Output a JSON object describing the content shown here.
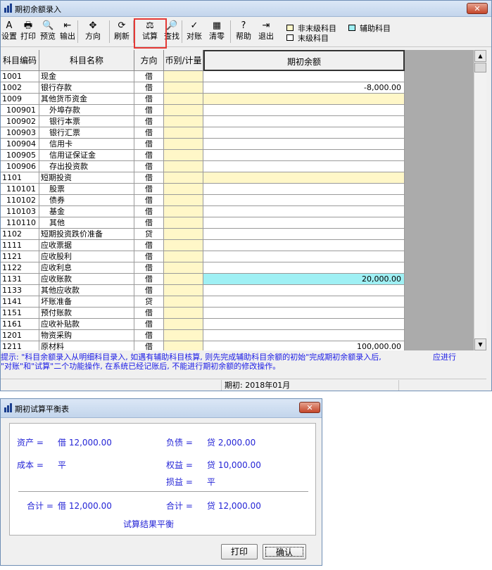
{
  "window1": {
    "title": "期初余额录入",
    "close_label": "✕",
    "toolbar": [
      {
        "label": "设置",
        "icon": "A"
      },
      {
        "label": "打印",
        "icon": "🖶"
      },
      {
        "label": "预览",
        "icon": "🔍"
      },
      {
        "label": "输出",
        "icon": "⇤"
      },
      {
        "label": "方向",
        "icon": "✥"
      },
      {
        "label": "刷新",
        "icon": "⟳"
      },
      {
        "label": "试算",
        "icon": "⚖"
      },
      {
        "label": "查找",
        "icon": "🔎"
      },
      {
        "label": "对账",
        "icon": "✓"
      },
      {
        "label": "清零",
        "icon": "▦"
      },
      {
        "label": "帮助",
        "icon": "?"
      },
      {
        "label": "退出",
        "icon": "⇥"
      }
    ],
    "legend": {
      "non_leaf": "非末级科目",
      "aux": "辅助科目",
      "leaf": "末级科目"
    },
    "legend_colors": {
      "non_leaf": "#fff7c8",
      "aux": "#9ff0f4",
      "leaf": "#ffffff"
    },
    "columns": {
      "code": "科目编码",
      "name": "科目名称",
      "dir": "方向",
      "cur": "币别/计量",
      "amount": "期初余额"
    },
    "rows": [
      {
        "code": "1001",
        "name": "现金",
        "dir": "借",
        "amount": "",
        "type": "leaf"
      },
      {
        "code": "1002",
        "name": "银行存款",
        "dir": "借",
        "amount": "-8,000.00",
        "type": "leaf"
      },
      {
        "code": "1009",
        "name": "其他货币资金",
        "dir": "借",
        "amount": "",
        "type": "parent"
      },
      {
        "code": "100901",
        "name": "外埠存款",
        "dir": "借",
        "amount": "",
        "type": "leaf"
      },
      {
        "code": "100902",
        "name": "银行本票",
        "dir": "借",
        "amount": "",
        "type": "leaf"
      },
      {
        "code": "100903",
        "name": "银行汇票",
        "dir": "借",
        "amount": "",
        "type": "leaf"
      },
      {
        "code": "100904",
        "name": "信用卡",
        "dir": "借",
        "amount": "",
        "type": "leaf"
      },
      {
        "code": "100905",
        "name": "信用证保证金",
        "dir": "借",
        "amount": "",
        "type": "leaf"
      },
      {
        "code": "100906",
        "name": "存出投资款",
        "dir": "借",
        "amount": "",
        "type": "leaf"
      },
      {
        "code": "1101",
        "name": "短期投资",
        "dir": "借",
        "amount": "",
        "type": "parent"
      },
      {
        "code": "110101",
        "name": "股票",
        "dir": "借",
        "amount": "",
        "type": "leaf"
      },
      {
        "code": "110102",
        "name": "债券",
        "dir": "借",
        "amount": "",
        "type": "leaf"
      },
      {
        "code": "110103",
        "name": "基金",
        "dir": "借",
        "amount": "",
        "type": "leaf"
      },
      {
        "code": "110110",
        "name": "其他",
        "dir": "借",
        "amount": "",
        "type": "leaf"
      },
      {
        "code": "1102",
        "name": "短期投资跌价准备",
        "dir": "贷",
        "amount": "",
        "type": "leaf"
      },
      {
        "code": "1111",
        "name": "应收票据",
        "dir": "借",
        "amount": "",
        "type": "leaf"
      },
      {
        "code": "1121",
        "name": "应收股利",
        "dir": "借",
        "amount": "",
        "type": "leaf"
      },
      {
        "code": "1122",
        "name": "应收利息",
        "dir": "借",
        "amount": "",
        "type": "leaf"
      },
      {
        "code": "1131",
        "name": "应收账款",
        "dir": "借",
        "amount": "20,000.00",
        "type": "aux"
      },
      {
        "code": "1133",
        "name": "其他应收款",
        "dir": "借",
        "amount": "",
        "type": "leaf"
      },
      {
        "code": "1141",
        "name": "坏账准备",
        "dir": "贷",
        "amount": "",
        "type": "leaf"
      },
      {
        "code": "1151",
        "name": "预付账款",
        "dir": "借",
        "amount": "",
        "type": "leaf"
      },
      {
        "code": "1161",
        "name": "应收补贴款",
        "dir": "借",
        "amount": "",
        "type": "leaf"
      },
      {
        "code": "1201",
        "name": "物资采购",
        "dir": "借",
        "amount": "",
        "type": "leaf"
      },
      {
        "code": "1211",
        "name": "原材料",
        "dir": "借",
        "amount": "100,000.00",
        "type": "leaf"
      }
    ],
    "tip_line1": "提示: \"科目余额录入从明细科目录入, 如遇有辅助科目核算, 则先完成辅助科目余额的初始\"完成期初余额录入后,",
    "tip_line1_right": "应进行",
    "tip_line2": "\"对账\"和\"试算\"二个功能操作, 在系统已经记账后, 不能进行期初余额的修改操作。",
    "status_period": "期初: 2018年01月"
  },
  "window2": {
    "title": "期初试算平衡表",
    "close_label": "✕",
    "assets_label": "资产 =",
    "assets_value": "借  12,000.00",
    "liab_label": "负债 =",
    "liab_value": "贷  2,000.00",
    "cost_label": "成本 =",
    "cost_value": "平",
    "equity_label": "权益 =",
    "equity_value": "贷  10,000.00",
    "pl_label": "损益 =",
    "pl_value": "平",
    "total_left_label": "合计 =",
    "total_left_value": "借  12,000.00",
    "total_right_label": "合计 =",
    "total_right_value": "贷  12,000.00",
    "result": "试算结果平衡",
    "print_button": "打印",
    "ok_button": "确认"
  }
}
